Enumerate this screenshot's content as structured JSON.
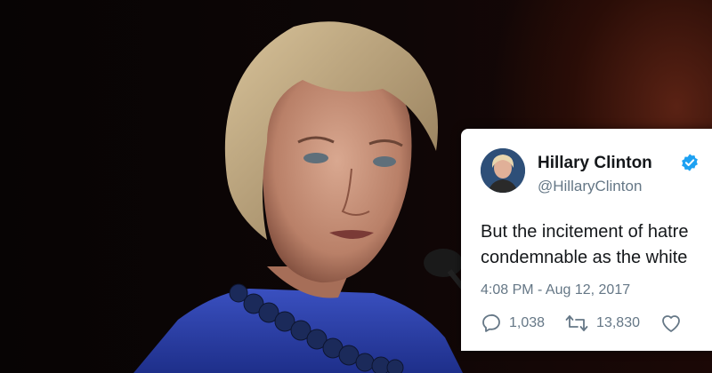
{
  "tweet": {
    "author_name": "Hillary Clinton",
    "author_handle": "@HillaryClinton",
    "text_line_1": "But the incitement of hatre",
    "text_line_2": "condemnable as the white",
    "timestamp": "4:08 PM - Aug 12, 2017",
    "reply_count": "1,038",
    "retweet_count": "13,830"
  },
  "icons": {
    "verified": "verified-badge-icon",
    "reply": "reply-icon",
    "retweet": "retweet-icon",
    "like": "heart-icon"
  },
  "colors": {
    "verified_blue": "#1da1f2",
    "text_primary": "#14171a",
    "text_secondary": "#657786",
    "blazer_blue": "#2c41a6"
  }
}
